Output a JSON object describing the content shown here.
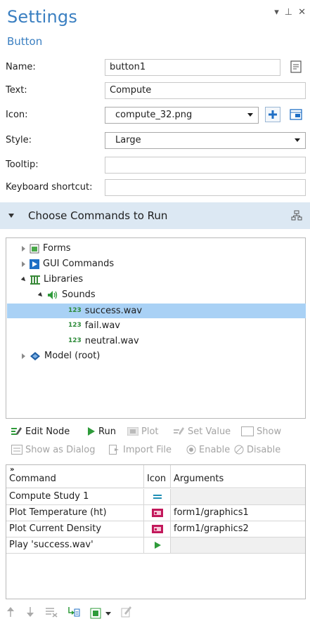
{
  "header": {
    "title": "Settings",
    "subtitle": "Button",
    "controls": [
      "▾",
      "⊥",
      "✕"
    ]
  },
  "form": {
    "name_label": "Name:",
    "name_value": "button1",
    "text_label": "Text:",
    "text_value": "Compute",
    "icon_label": "Icon:",
    "icon_value": "compute_32.png",
    "style_label": "Style:",
    "style_value": "Large",
    "tooltip_label": "Tooltip:",
    "tooltip_value": "",
    "shortcut_label": "Keyboard shortcut:",
    "shortcut_value": ""
  },
  "section": {
    "title": "Choose Commands to Run"
  },
  "tree": {
    "forms": "Forms",
    "gui_commands": "GUI Commands",
    "libraries": "Libraries",
    "sounds": "Sounds",
    "num_badge": "123",
    "sound_files": [
      "success.wav",
      "fail.wav",
      "neutral.wav"
    ],
    "model": "Model (root)"
  },
  "toolbar": {
    "edit_node": "Edit Node",
    "run": "Run",
    "plot": "Plot",
    "set_value": "Set Value",
    "show": "Show",
    "show_as_dialog": "Show as Dialog",
    "import_file": "Import File",
    "enable": "Enable",
    "disable": "Disable"
  },
  "table": {
    "columns": [
      "Command",
      "Icon",
      "Arguments"
    ],
    "rows": [
      {
        "command": "Compute Study 1",
        "icon": "compute-icon",
        "arguments": ""
      },
      {
        "command": "Plot Temperature (ht)",
        "icon": "plot-icon",
        "arguments": "form1/graphics1"
      },
      {
        "command": "Plot Current Density",
        "icon": "plot-icon",
        "arguments": "form1/graphics2"
      },
      {
        "command": "Play 'success.wav'",
        "icon": "play-icon",
        "arguments": ""
      }
    ]
  },
  "colors": {
    "accent": "#3a7fc1",
    "section_bg": "#dce8f3",
    "selection": "#a9d1f5",
    "run_green": "#2e9b3a",
    "plot_magenta": "#c2185b"
  }
}
